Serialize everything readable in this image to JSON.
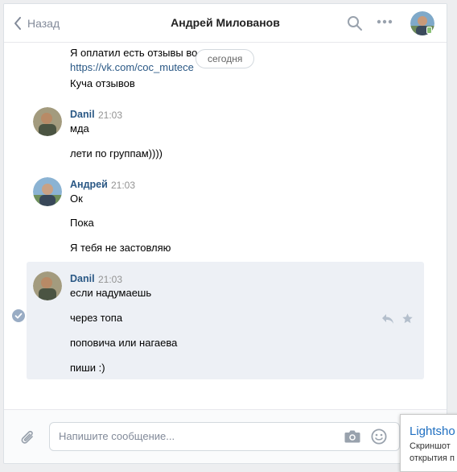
{
  "header": {
    "back_label": "Назад",
    "title": "Андрей Милованов"
  },
  "history": {
    "date_divider": "сегодня",
    "top_lines": [
      "Я оплатил есть отзывы во",
      "https://vk.com/coc_mutece",
      "Куча отзывов"
    ],
    "groups": [
      {
        "sender": "Danil",
        "time": "21:03",
        "messages": [
          "мда",
          "лети по группам))))"
        ]
      },
      {
        "sender": "Андрей",
        "time": "21:03",
        "messages": [
          "Ок",
          "Пока",
          "Я тебя не застовляю"
        ]
      },
      {
        "sender": "Danil",
        "time": "21:03",
        "messages": [
          "если надумаешь",
          "через топа",
          "поповича или нагаева",
          "пиши :)"
        ],
        "selected": true
      }
    ]
  },
  "composer": {
    "placeholder": "Напишите сообщение..."
  },
  "lightshot": {
    "title": "Lightsho",
    "line1": "Скриншот",
    "line2": "открытия п"
  },
  "colors": {
    "link": "#2a5885",
    "selected_bg": "#edf0f5",
    "online": "#8ac176",
    "lightshot_blue": "#1f6fc1"
  },
  "icons": [
    "chevron-left-icon",
    "search-icon",
    "more-icon",
    "check-circle-icon",
    "reply-icon",
    "star-icon",
    "paperclip-icon",
    "camera-icon",
    "smile-icon"
  ]
}
